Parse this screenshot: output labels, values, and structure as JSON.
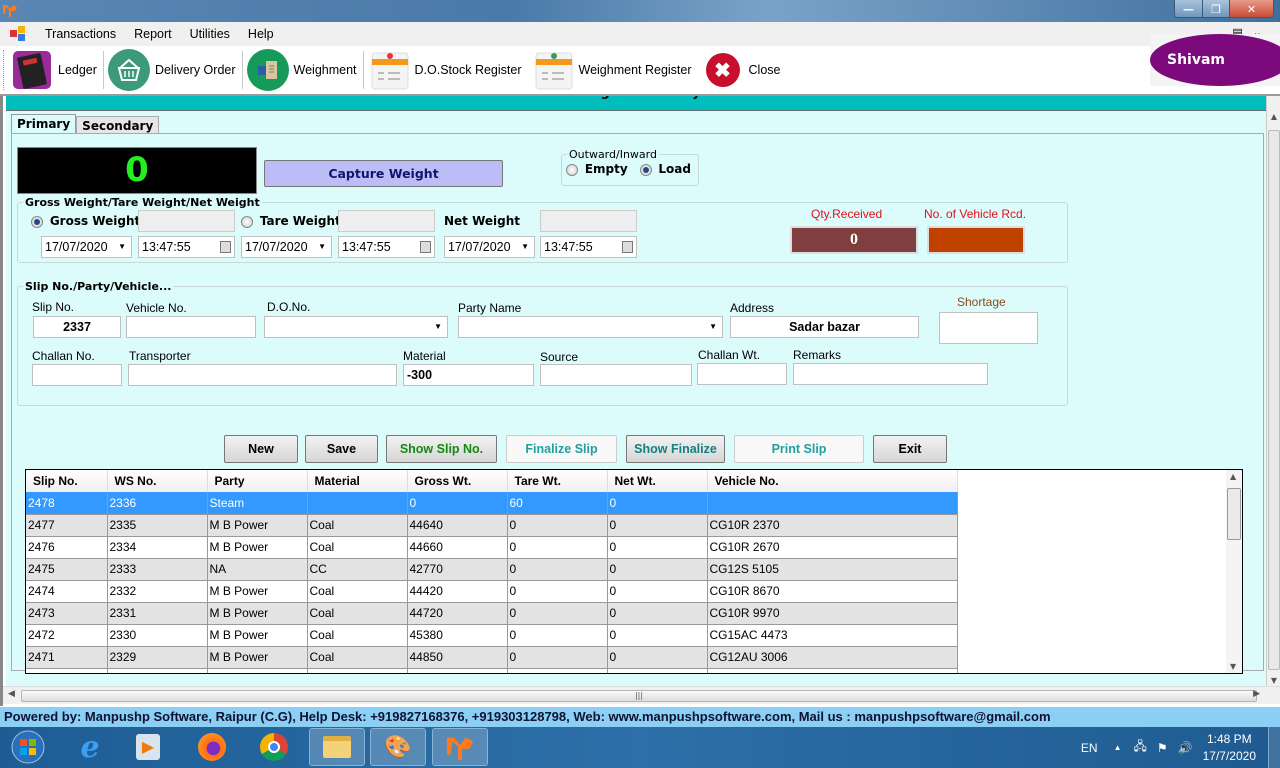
{
  "window": {
    "title": ""
  },
  "menu": {
    "items": [
      "Transactions",
      "Report",
      "Utilities",
      "Help"
    ]
  },
  "toolbar": {
    "items": [
      {
        "label": "Ledger",
        "icon": "ledger-book-icon"
      },
      {
        "label": "Delivery Order",
        "icon": "basket-icon"
      },
      {
        "label": "Weighment",
        "icon": "weighment-icon"
      },
      {
        "label": "D.O.Stock Register",
        "icon": "register-icon"
      },
      {
        "label": "Weighment Register",
        "icon": "register-icon"
      },
      {
        "label": "Close",
        "icon": "close-circle-icon"
      }
    ]
  },
  "user": {
    "name": "Shivam"
  },
  "form": {
    "title": "Weighment Entry",
    "tabs": [
      "Primary",
      "Secondary"
    ],
    "weight_display": "0",
    "capture_button": "Capture Weight",
    "direction": {
      "legend": "Outward/Inward",
      "options": [
        "Empty",
        "Load"
      ],
      "selected": "Load"
    },
    "weights": {
      "legend": "Gross Weight/Tare Weight/Net Weight",
      "gross_label": "Gross Weight",
      "tare_label": "Tare Weight",
      "net_label": "Net Weight",
      "selected": "Gross Weight",
      "gross_value": "",
      "tare_value": "",
      "net_value": "",
      "gross_date": "17/07/2020",
      "gross_time": "13:47:55",
      "tare_date": "17/07/2020",
      "tare_time": "13:47:55",
      "net_date": "17/07/2020",
      "net_time": "13:47:55"
    },
    "stats": {
      "qty_label": "Qty.Received",
      "qty_value": "0",
      "vehicle_label": "No. of Vehicle Rcd.",
      "vehicle_value": "",
      "qty_color": "#7f3f3f",
      "vehicle_color": "#c04000"
    },
    "slip": {
      "legend": "Slip No./Party/Vehicle...",
      "slip_no_label": "Slip No.",
      "slip_no": "2337",
      "vehicle_no_label": "Vehicle No.",
      "vehicle_no": "",
      "do_no_label": "D.O.No.",
      "do_no": "",
      "party_label": "Party Name",
      "party": "",
      "address_label": "Address",
      "address": "Sadar bazar",
      "shortage_label": "Shortage",
      "shortage": "",
      "challan_no_label": "Challan No.",
      "challan_no": "",
      "transporter_label": "Transporter",
      "transporter": "",
      "material_label": "Material",
      "material": "-300",
      "source_label": "Source",
      "source": "",
      "challan_wt_label": "Challan Wt.",
      "challan_wt": "",
      "remarks_label": "Remarks",
      "remarks": ""
    },
    "buttons": {
      "new": "New",
      "save": "Save",
      "show_slip": "Show Slip No.",
      "finalize": "Finalize Slip",
      "show_finalize": "Show Finalize",
      "print": "Print Slip",
      "exit": "Exit"
    },
    "grid": {
      "columns": [
        "Slip No.",
        "WS No.",
        "Party",
        "Material",
        "Gross Wt.",
        "Tare Wt.",
        "Net Wt.",
        "Vehicle No."
      ],
      "rows": [
        [
          "2478",
          "2336",
          "Steam",
          "",
          "0",
          "60",
          "0",
          ""
        ],
        [
          "2477",
          "2335",
          "M B Power",
          "Coal",
          "44640",
          "0",
          "0",
          "CG10R 2370"
        ],
        [
          "2476",
          "2334",
          "M B Power",
          "Coal",
          "44660",
          "0",
          "0",
          "CG10R 2670"
        ],
        [
          "2475",
          "2333",
          "NA",
          "CC",
          "42770",
          "0",
          "0",
          "CG12S 5105"
        ],
        [
          "2474",
          "2332",
          "M B Power",
          "Coal",
          "44420",
          "0",
          "0",
          "CG10R 8670"
        ],
        [
          "2473",
          "2331",
          "M B Power",
          "Coal",
          "44720",
          "0",
          "0",
          "CG10R 9970"
        ],
        [
          "2472",
          "2330",
          "M B Power",
          "Coal",
          "45380",
          "0",
          "0",
          "CG15AC 4473"
        ],
        [
          "2471",
          "2329",
          "M B Power",
          "Coal",
          "44850",
          "0",
          "0",
          "CG12AU 3006"
        ]
      ],
      "selected_row": 0
    }
  },
  "footer": {
    "text": "Powered by: Manpushp Software, Raipur (C.G), Help Desk: +919827168376, +919303128798, Web: www.manpushpsoftware.com,  Mail us :  manpushpsoftware@gmail.com"
  },
  "taskbar": {
    "apps": [
      "start-button",
      "internet-explorer",
      "media-player",
      "firefox",
      "chrome",
      "file-explorer",
      "paint",
      "manpushp-app"
    ],
    "language": "EN",
    "time": "1:48 PM",
    "date": "17/7/2020"
  }
}
